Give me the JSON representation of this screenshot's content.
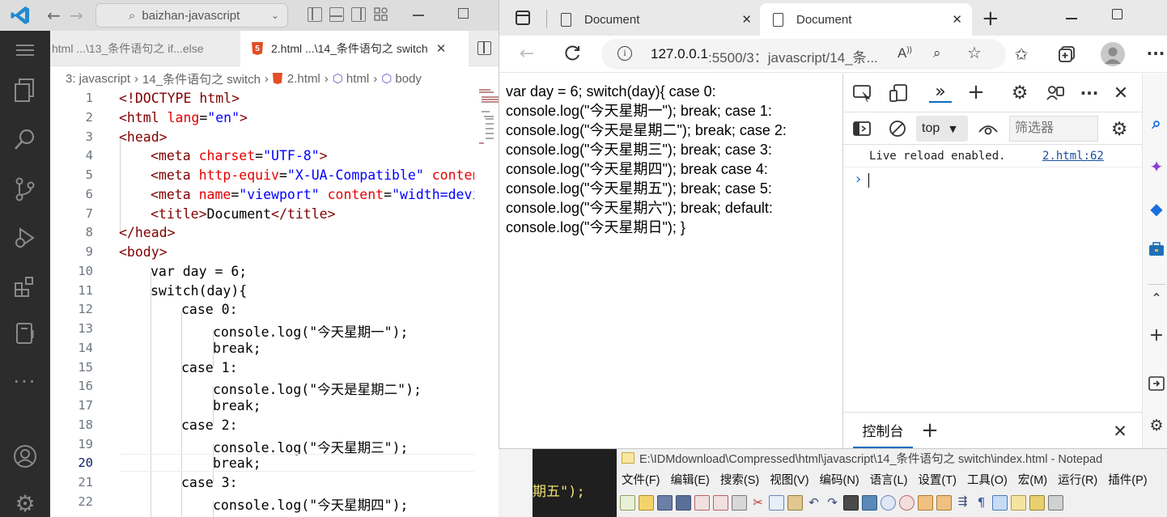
{
  "vscode": {
    "search_text": "baizhan-javascript",
    "tabs": [
      {
        "label": "html   ...\\13_条件语句之 if...else"
      },
      {
        "label": "2.html   ...\\14_条件语句之 switch"
      }
    ],
    "tab_html_badge": "5",
    "breadcrumbs": [
      "3: javascript",
      "14_条件语句之 switch",
      "2.html",
      "html",
      "body"
    ],
    "line_numbers": [
      "1",
      "2",
      "3",
      "4",
      "5",
      "6",
      "7",
      "8",
      "9",
      "10",
      "11",
      "12",
      "13",
      "14",
      "15",
      "16",
      "17",
      "18",
      "19",
      "20",
      "21",
      "22"
    ],
    "current_line": "20",
    "lines": {
      "l1": "<!DOCTYPE html>",
      "l2_tag": "<html ",
      "l2_attr": "lang",
      "l2_eq": "=",
      "l2_val": "\"en\"",
      "l2_end": ">",
      "l3": "<head>",
      "l4_tag": "<meta ",
      "l4_attr": "charset",
      "l4_eq": "=",
      "l4_val": "\"UTF-8\"",
      "l4_end": ">",
      "l5_tag": "<meta ",
      "l5_attr": "http-equiv",
      "l5_eq": "=",
      "l5_val": "\"X-UA-Compatible\"",
      "l5_attr2": " content",
      "l6_tag": "<meta ",
      "l6_attr": "name",
      "l6_eq": "=",
      "l6_val": "\"viewport\"",
      "l6_attr2": " content",
      "l6_eq2": "=",
      "l6_val2": "\"width=devic",
      "l7_open": "<title>",
      "l7_text": "Document",
      "l7_close": "</title>",
      "l8": "</head>",
      "l9": "<body>",
      "l10": "var day = 6;",
      "l11": "switch(day){",
      "l12": "case 0:",
      "l13": "console.log(\"今天星期一\");",
      "l14": "break;",
      "l15": "case 1:",
      "l16": "console.log(\"今天是星期二\");",
      "l17": "break;",
      "l18": "case 2:",
      "l19": "console.log(\"今天星期三\");",
      "l20": "break;",
      "l21": "case 3:",
      "l22": "console.log(\"今天星期四\");"
    },
    "behind_text": "期五\");"
  },
  "browser": {
    "tabs": [
      {
        "label": "Document"
      },
      {
        "label": "Document"
      }
    ],
    "address_host": "127.0.0.1",
    "address_rest": ":5500/3：javascript/14_条...",
    "page_lines": [
      "var day = 6; switch(day){ case 0:",
      "console.log(\"今天星期一\"); break; case 1:",
      "console.log(\"今天是星期二\"); break; case 2:",
      "console.log(\"今天星期三\"); break; case 3:",
      "console.log(\"今天星期四\"); break case 4:",
      "console.log(\"今天星期五\"); break; case 5:",
      "console.log(\"今天星期六\"); break; default:",
      "console.log(\"今天星期日\"); }"
    ],
    "devtools": {
      "context": "top",
      "filter_placeholder": "筛选器",
      "log_message": "Live reload enabled.",
      "log_source": "2.html:62",
      "drawer_tab": "控制台"
    }
  },
  "notepad": {
    "title": "E:\\IDMdownload\\Compressed\\html\\javascript\\14_条件语句之 switch\\index.html - Notepad",
    "menu": [
      "文件(F)",
      "编辑(E)",
      "搜索(S)",
      "视图(V)",
      "编码(N)",
      "语言(L)",
      "设置(T)",
      "工具(O)",
      "宏(M)",
      "运行(R)",
      "插件(P)"
    ]
  },
  "colors": {
    "vscode_accent": "#0066b8",
    "edge_accent": "#0f6cbd",
    "html_icon": "#e44d26"
  }
}
